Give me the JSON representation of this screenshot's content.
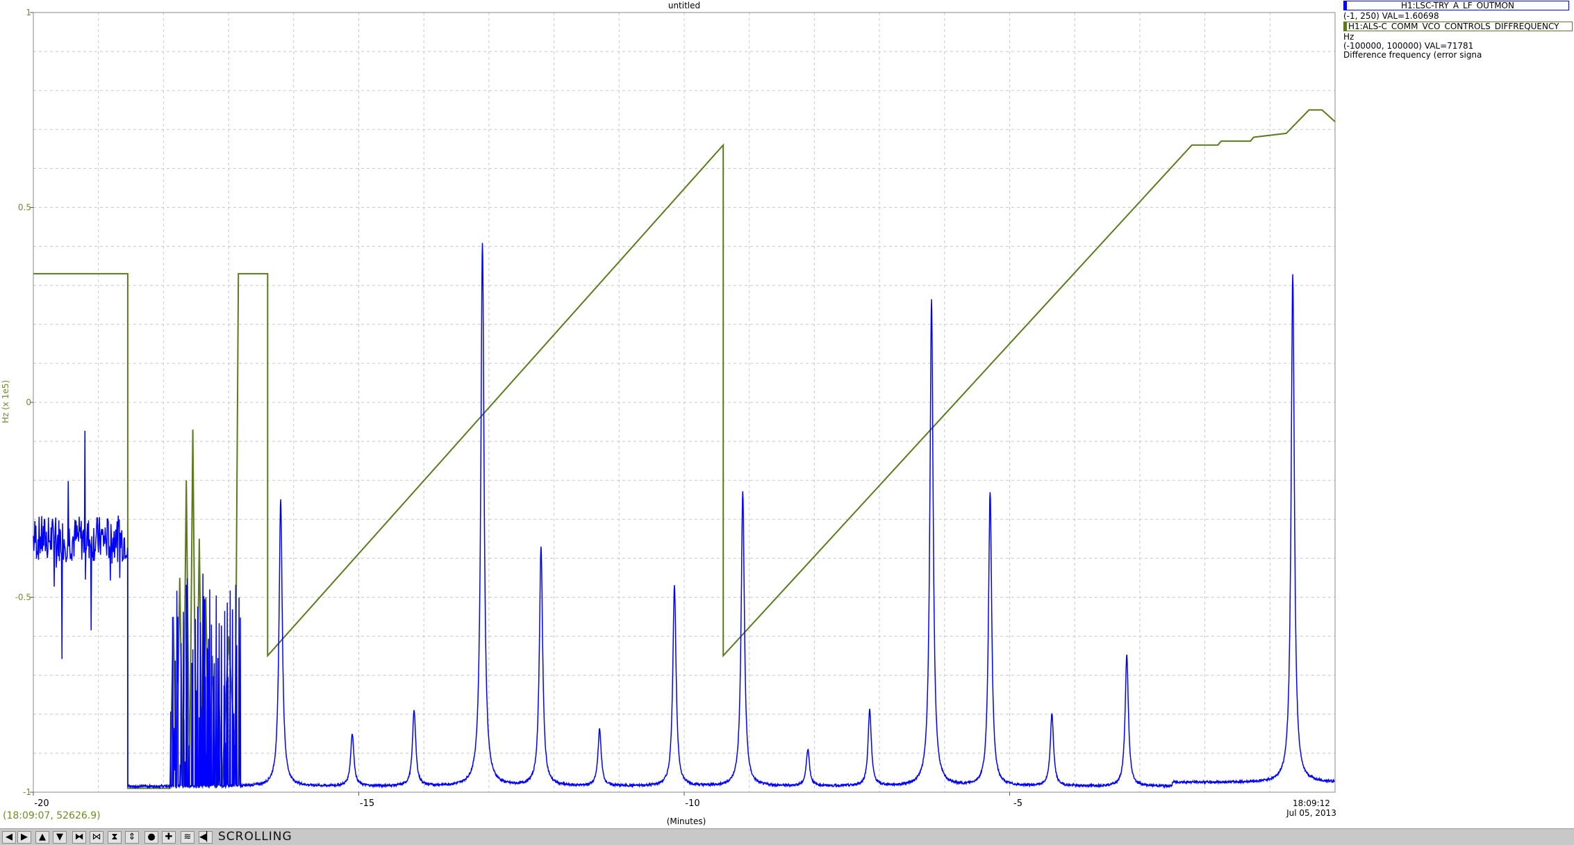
{
  "window": {
    "title": "untitled"
  },
  "chart_data": {
    "type": "line",
    "title": "untitled",
    "xlabel": "(Minutes)",
    "ylabel": "Hz (x 1e5)",
    "xlim": [
      -20,
      0
    ],
    "ylim": [
      -1,
      1
    ],
    "x_ticks": [
      "-20",
      "-15",
      "-10",
      "-5"
    ],
    "y_ticks": [
      "1",
      "0.5",
      "0",
      "-0.5",
      "-1"
    ],
    "end_time": "18:09:12",
    "end_date": "Jul 05, 2013",
    "grid": true,
    "colors": {
      "blue_series": "#0000ff",
      "green_series": "#5a7a1c",
      "grid": "#c8c8c8"
    },
    "series": [
      {
        "name": "H1:LSC-TRY_A_LF_OUTMON",
        "range": "(-1, 250) VAL=1.60698",
        "color": "#0000ff",
        "baseline": -0.985,
        "noise_region": {
          "x": [
            -20,
            -18.55
          ],
          "y_center": -0.35,
          "y_span": 0.12
        },
        "peaks": [
          {
            "x": -16.2,
            "y": -0.25
          },
          {
            "x": -15.1,
            "y": -0.85
          },
          {
            "x": -14.15,
            "y": -0.79
          },
          {
            "x": -13.1,
            "y": 0.41
          },
          {
            "x": -12.2,
            "y": -0.37
          },
          {
            "x": -11.3,
            "y": -0.84
          },
          {
            "x": -10.15,
            "y": -0.47
          },
          {
            "x": -9.1,
            "y": -0.23
          },
          {
            "x": -8.1,
            "y": -0.89
          },
          {
            "x": -7.15,
            "y": -0.79
          },
          {
            "x": -6.2,
            "y": 0.26
          },
          {
            "x": -5.3,
            "y": -0.23
          },
          {
            "x": -4.35,
            "y": -0.8
          },
          {
            "x": -3.2,
            "y": -0.65
          },
          {
            "x": -0.65,
            "y": 0.32
          }
        ]
      },
      {
        "name": "H1:ALS-C_COMM_VCO_CONTROLS_DIFFREQUENCY",
        "unit": "Hz",
        "range": "(-100000, 100000) VAL=71781",
        "description": "Difference frequency (error signa",
        "color": "#5a7a1c",
        "points": [
          [
            -20,
            0.33
          ],
          [
            -18.55,
            0.33
          ],
          [
            -18.55,
            -0.99
          ],
          [
            -17.9,
            -0.99
          ],
          [
            -17.85,
            -0.55
          ],
          [
            -17.8,
            -0.99
          ],
          [
            -17.75,
            -0.45
          ],
          [
            -17.7,
            -0.99
          ],
          [
            -17.65,
            -0.2
          ],
          [
            -17.6,
            -0.99
          ],
          [
            -17.55,
            -0.07
          ],
          [
            -17.5,
            -0.99
          ],
          [
            -17.45,
            -0.35
          ],
          [
            -17.4,
            -0.99
          ],
          [
            -17.35,
            -0.5
          ],
          [
            -17.3,
            -0.99
          ],
          [
            -17.25,
            -0.65
          ],
          [
            -17.2,
            -0.99
          ],
          [
            -17.15,
            -0.75
          ],
          [
            -17.1,
            -0.99
          ],
          [
            -17.0,
            -0.6
          ],
          [
            -16.9,
            -0.9
          ],
          [
            -16.85,
            0.33
          ],
          [
            -16.4,
            0.33
          ],
          [
            -16.4,
            -0.65
          ],
          [
            -9.4,
            0.66
          ],
          [
            -9.4,
            -0.65
          ],
          [
            -2.2,
            0.66
          ],
          [
            -1.8,
            0.66
          ],
          [
            -1.75,
            0.67
          ],
          [
            -1.3,
            0.67
          ],
          [
            -1.25,
            0.68
          ],
          [
            -0.75,
            0.69
          ],
          [
            -0.4,
            0.75
          ],
          [
            -0.2,
            0.75
          ],
          [
            0,
            0.72
          ]
        ]
      }
    ]
  },
  "cursor_readout": "(18:09:07, 52626.9)",
  "toolbar": {
    "mode": "SCROLLING"
  }
}
